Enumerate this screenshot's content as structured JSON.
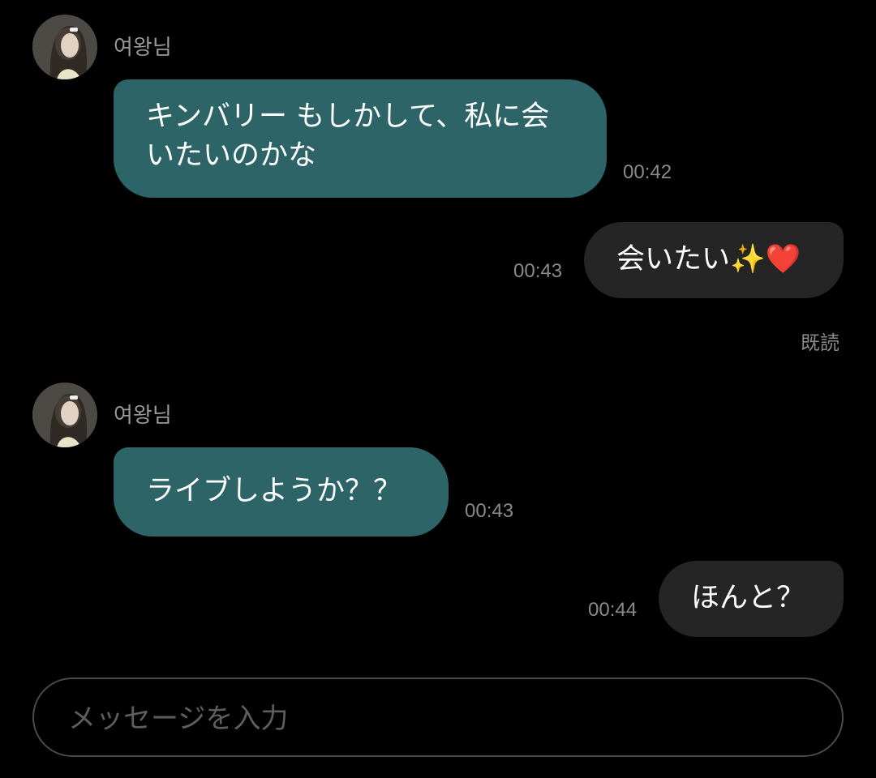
{
  "messages": [
    {
      "sender": "여왕님",
      "text": "キンバリー もしかして、私に会いたいのかな",
      "time": "00:42"
    },
    {
      "text": "会いたい✨❤️",
      "time": "00:43",
      "status": "既読"
    },
    {
      "sender": "여왕님",
      "text": "ライブしようか？？",
      "time": "00:43"
    },
    {
      "text": "ほんと？",
      "time": "00:44"
    }
  ],
  "composer": {
    "placeholder": "メッセージを入力"
  }
}
